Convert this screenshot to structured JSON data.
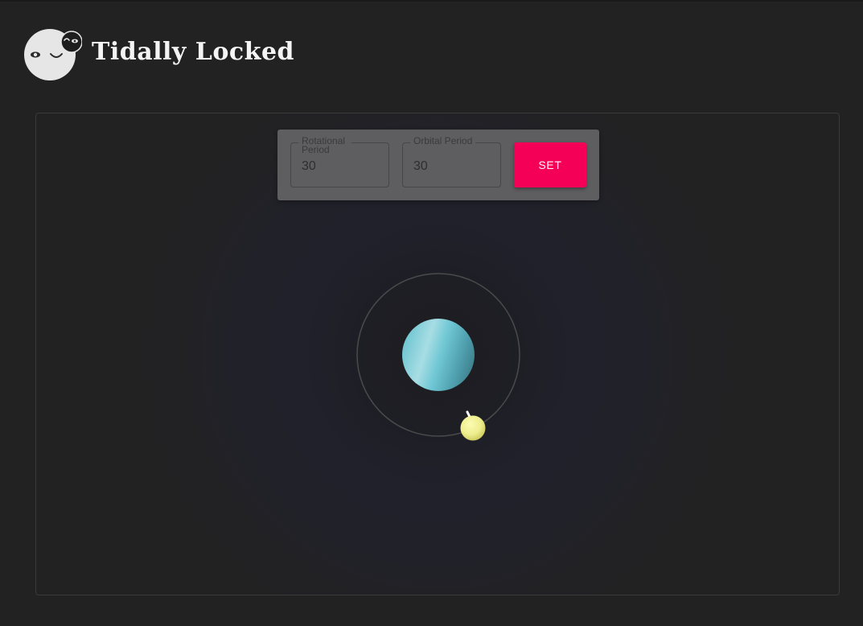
{
  "app": {
    "title": "Tidally Locked"
  },
  "controls": {
    "rotational_period": {
      "label": "Rotational Period",
      "value": "30"
    },
    "orbital_period": {
      "label": "Orbital Period",
      "value": "30"
    },
    "set_label": "SET"
  },
  "scene": {
    "planet_colors": [
      "#6cc5d0",
      "#a8dde4",
      "#3e7f8a"
    ],
    "moon_colors": [
      "#fbfbb2",
      "#c9c75a"
    ],
    "orbit_color": "#4a4a4a",
    "accent_color": "#f50057"
  }
}
